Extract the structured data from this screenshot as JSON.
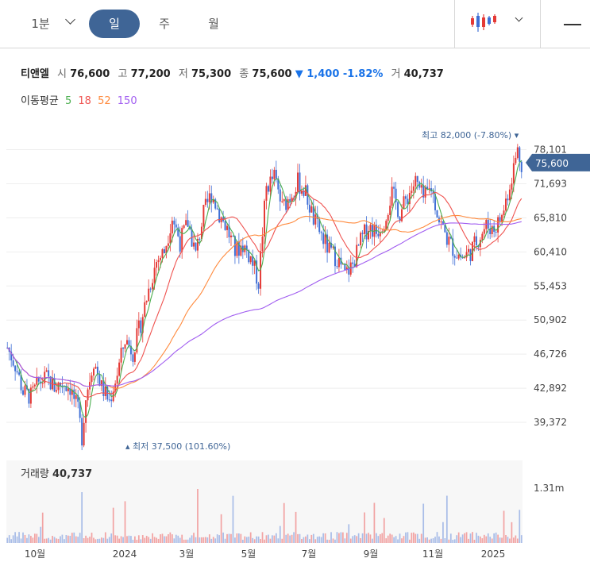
{
  "toolbar": {
    "interval_label": "1분",
    "tabs": [
      "일",
      "주",
      "월"
    ],
    "selected_tab": "일",
    "accent": "#3f6596"
  },
  "quote": {
    "name": "티앤엘",
    "open_label": "시",
    "open": "76,600",
    "high_label": "고",
    "high": "77,200",
    "low_label": "저",
    "low": "75,300",
    "close_label": "종",
    "close": "75,600",
    "change": "▼ 1,400 -1.82%",
    "volume_label": "거",
    "volume": "40,737"
  },
  "moving_avg": {
    "label": "이동평균",
    "periods": [
      {
        "period": "5",
        "color": "#4caf50"
      },
      {
        "period": "18",
        "color": "#ef5350"
      },
      {
        "period": "52",
        "color": "#ff8a3d"
      },
      {
        "period": "150",
        "color": "#a05cf0"
      }
    ]
  },
  "chart_data": {
    "type": "candlestick",
    "y_ticks": [
      "78,101",
      "71,693",
      "65,810",
      "60,410",
      "55,453",
      "50,902",
      "46,726",
      "42,892",
      "39,372"
    ],
    "ylim": [
      36500,
      83000
    ],
    "y_scale": "log",
    "x_ticks": [
      "10월",
      "2024",
      "3월",
      "5월",
      "7월",
      "9월",
      "11월",
      "2025"
    ],
    "current_price_label": "75,600",
    "max_annotation": {
      "text": "최고",
      "value": "82,000 (-7.80%)"
    },
    "min_annotation": {
      "text": "최저",
      "value": "37,500 (101.60%)"
    },
    "price_path": [
      [
        0,
        47500
      ],
      [
        4,
        45500
      ],
      [
        8,
        42500
      ],
      [
        12,
        42000
      ],
      [
        16,
        43500
      ],
      [
        20,
        44000
      ],
      [
        24,
        43000
      ],
      [
        28,
        43500
      ],
      [
        32,
        43000
      ],
      [
        36,
        40500
      ],
      [
        38,
        38000
      ],
      [
        40,
        42000
      ],
      [
        44,
        46000
      ],
      [
        48,
        43000
      ],
      [
        52,
        41500
      ],
      [
        56,
        44500
      ],
      [
        60,
        48500
      ],
      [
        64,
        47000
      ],
      [
        68,
        50500
      ],
      [
        72,
        55000
      ],
      [
        76,
        59000
      ],
      [
        80,
        60500
      ],
      [
        84,
        66000
      ],
      [
        88,
        62000
      ],
      [
        92,
        65000
      ],
      [
        96,
        60000
      ],
      [
        100,
        66500
      ],
      [
        104,
        70000
      ],
      [
        108,
        66500
      ],
      [
        112,
        64000
      ],
      [
        116,
        60500
      ],
      [
        120,
        61500
      ],
      [
        124,
        59500
      ],
      [
        128,
        56000
      ],
      [
        132,
        71000
      ],
      [
        136,
        73000
      ],
      [
        140,
        67500
      ],
      [
        144,
        69500
      ],
      [
        148,
        72000
      ],
      [
        152,
        70000
      ],
      [
        156,
        65500
      ],
      [
        160,
        63000
      ],
      [
        164,
        60500
      ],
      [
        168,
        59500
      ],
      [
        172,
        57000
      ],
      [
        176,
        58500
      ],
      [
        180,
        62000
      ],
      [
        184,
        64500
      ],
      [
        188,
        63500
      ],
      [
        192,
        65500
      ],
      [
        196,
        70000
      ],
      [
        200,
        66500
      ],
      [
        204,
        69500
      ],
      [
        208,
        72000
      ],
      [
        212,
        69000
      ],
      [
        216,
        71000
      ],
      [
        220,
        65500
      ],
      [
        224,
        62500
      ],
      [
        228,
        60500
      ],
      [
        232,
        59500
      ],
      [
        236,
        60500
      ],
      [
        240,
        62500
      ],
      [
        244,
        64500
      ],
      [
        248,
        64000
      ],
      [
        252,
        66000
      ],
      [
        256,
        71500
      ],
      [
        260,
        78000
      ],
      [
        262,
        75600
      ]
    ],
    "volume_label": "거래량",
    "volume": "40,737",
    "volume_axis_tick": "1.31m"
  }
}
